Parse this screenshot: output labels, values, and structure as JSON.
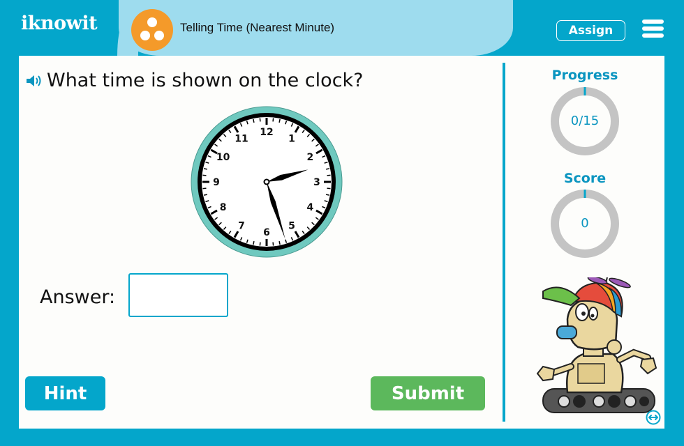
{
  "app": {
    "logo_text": "iknowit",
    "lesson_title": "Telling Time (Nearest Minute)",
    "lesson_icon": "three-dots-circle-icon",
    "assign_label": "Assign",
    "menu_icon": "hamburger-menu-icon"
  },
  "question": {
    "audio_icon": "speaker-icon",
    "text": "What time is shown on the clock?"
  },
  "clock": {
    "numerals": [
      "12",
      "1",
      "2",
      "3",
      "4",
      "5",
      "6",
      "7",
      "8",
      "9",
      "10",
      "11"
    ],
    "hour": 2,
    "minute": 27,
    "rim_color": "#6fc9bf"
  },
  "answer": {
    "label": "Answer:",
    "value": "",
    "placeholder": ""
  },
  "buttons": {
    "hint": "Hint",
    "submit": "Submit"
  },
  "sidebar": {
    "progress": {
      "label": "Progress",
      "value_text": "0/15",
      "current": 0,
      "total": 15
    },
    "score": {
      "label": "Score",
      "value_text": "0",
      "value": 0,
      "max": 100
    },
    "mascot": "robot-mascot",
    "swap_icon": "swap-horizontal-icon"
  },
  "colors": {
    "brand_blue": "#04a6cb",
    "title_bar": "#9edcee",
    "lesson_orange": "#f49a2a",
    "submit_green": "#5cb85c",
    "ring_gray": "#c4c4c4",
    "stat_text": "#0b95c0"
  }
}
